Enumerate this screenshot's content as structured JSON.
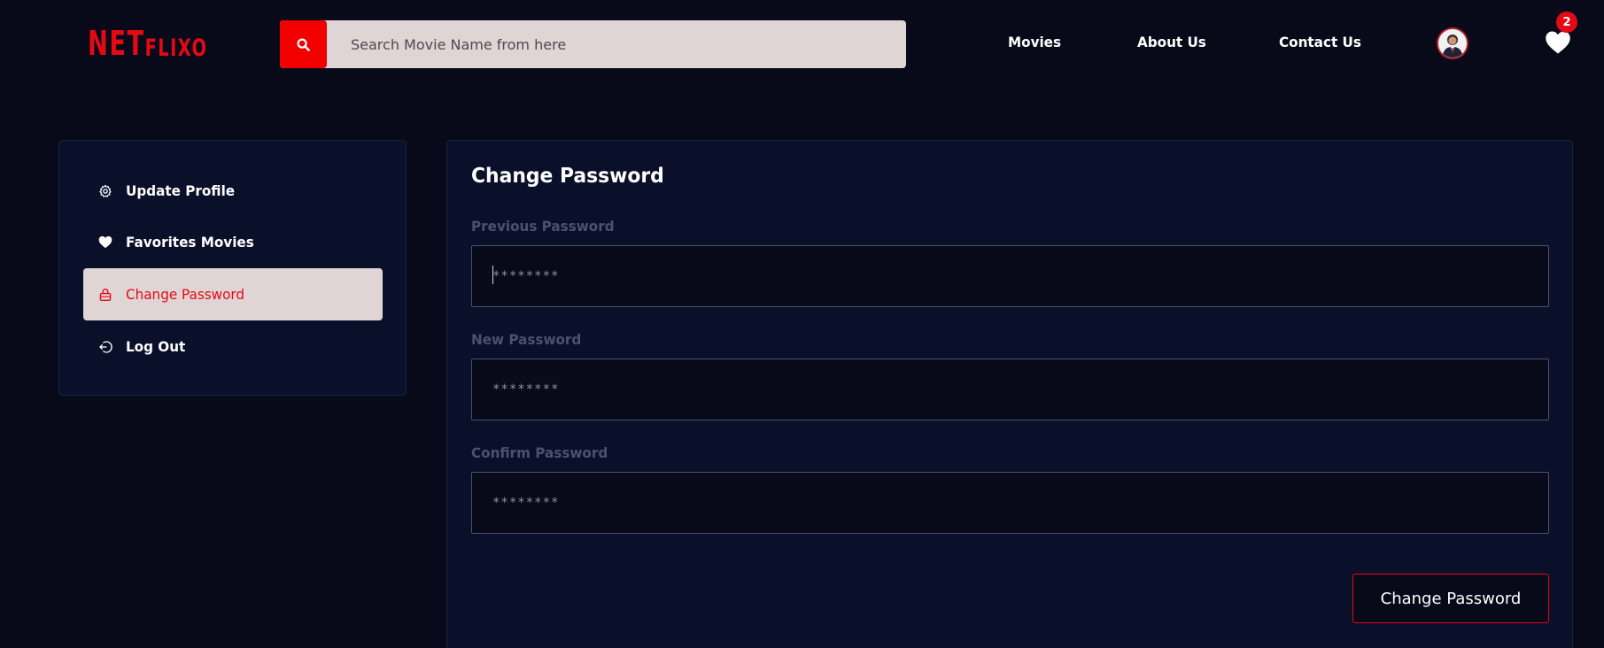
{
  "header": {
    "logo": {
      "big": "NET",
      "small": "FLIXO"
    },
    "search": {
      "placeholder": "Search Movie Name from here",
      "icon": "search-icon"
    },
    "nav": [
      {
        "label": "Movies"
      },
      {
        "label": "About Us"
      },
      {
        "label": "Contact Us"
      }
    ],
    "favorites_count": "2"
  },
  "sidebar": {
    "items": [
      {
        "label": "Update Profile",
        "icon": "gear-icon",
        "active": false
      },
      {
        "label": "Favorites Movies",
        "icon": "heart-icon",
        "active": false
      },
      {
        "label": "Change Password",
        "icon": "lock-icon",
        "active": true
      },
      {
        "label": "Log Out",
        "icon": "logout-icon",
        "active": false
      }
    ]
  },
  "main": {
    "title": "Change Password",
    "fields": [
      {
        "label": "Previous Password",
        "placeholder": "********"
      },
      {
        "label": "New Password",
        "placeholder": "********"
      },
      {
        "label": "Confirm Password",
        "placeholder": "********"
      }
    ],
    "submit_label": "Change Password"
  },
  "colors": {
    "brand": "#e50914",
    "background": "#080a1a",
    "panel": "#0a0f2a",
    "active_item_bg": "#e0d5d5"
  }
}
